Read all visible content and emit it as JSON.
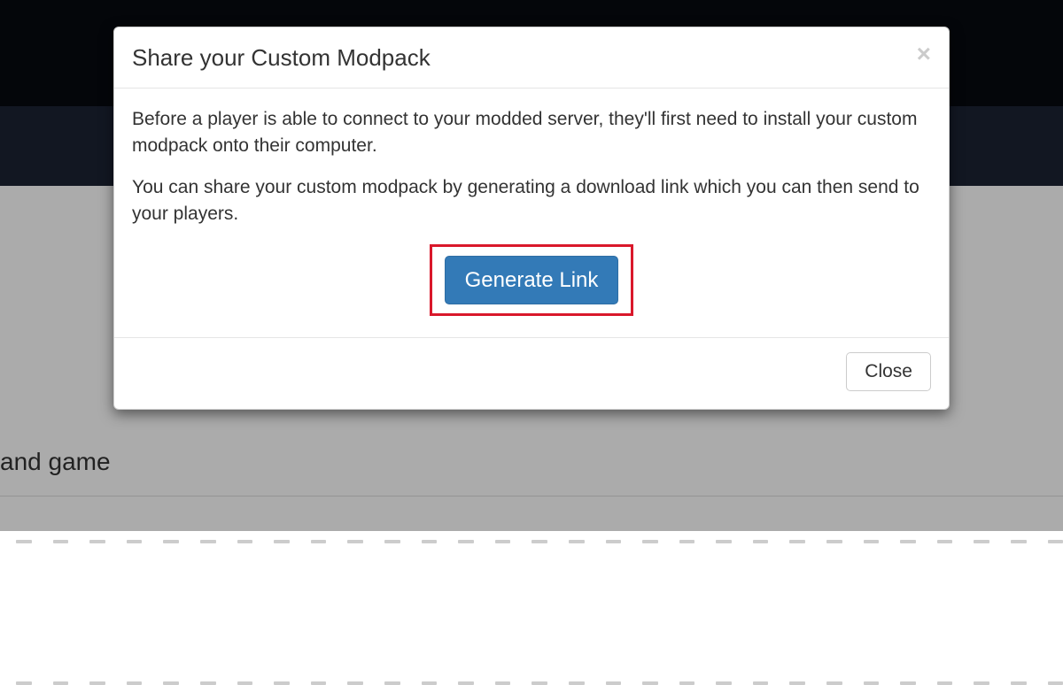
{
  "background": {
    "partial_text": "and game"
  },
  "modal": {
    "title": "Share your Custom Modpack",
    "close_icon": "×",
    "para1": "Before a player is able to connect to your modded server, they'll first need to install your custom modpack onto their computer.",
    "para2": "You can share your custom modpack by generating a download link which you can then send to your players.",
    "generate_button": "Generate Link",
    "close_button": "Close"
  }
}
